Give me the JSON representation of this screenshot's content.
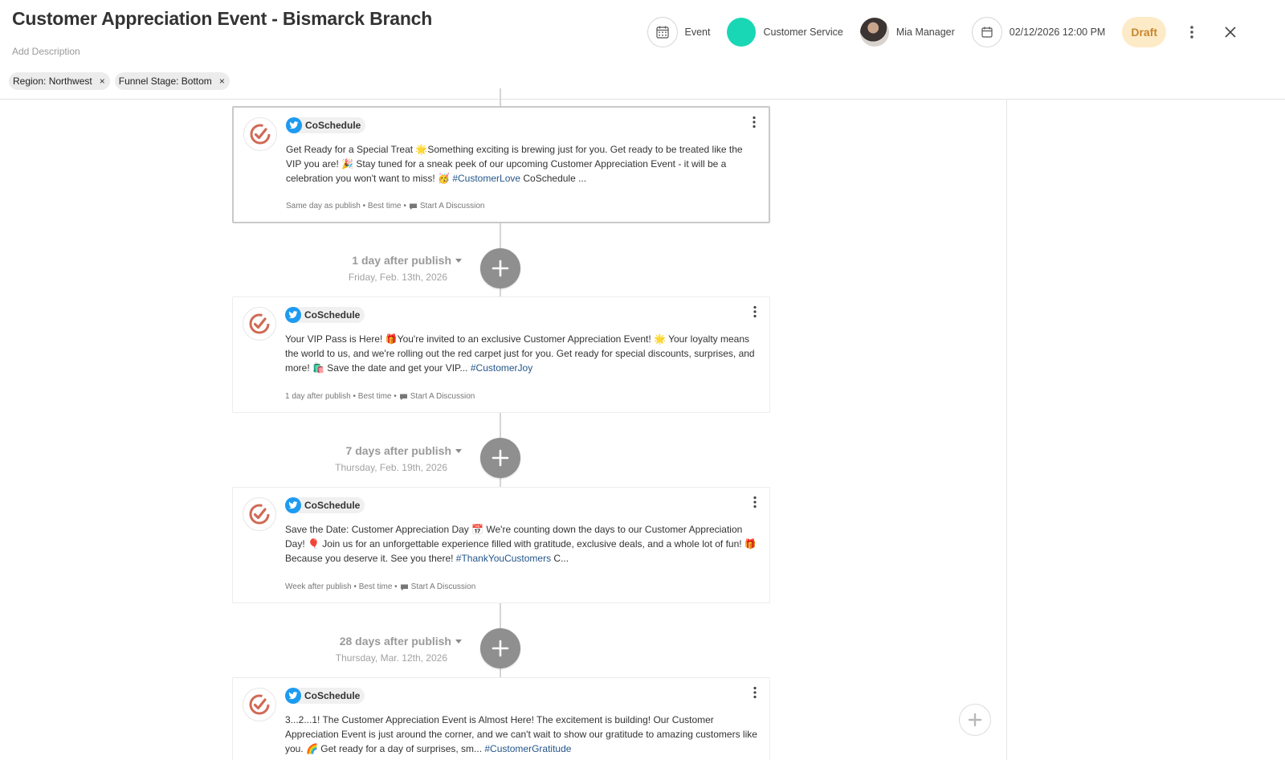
{
  "header": {
    "title": "Customer Appreciation Event - Bismarck Branch",
    "add_description": "Add Description",
    "tags": [
      {
        "label": "Region: Northwest",
        "remove": "×"
      },
      {
        "label": "Funnel Stage: Bottom",
        "remove": "×"
      }
    ],
    "type_label": "Event",
    "team_label": "Customer Service",
    "team_color": "#19d7b4",
    "owner_name": "Mia Manager",
    "datetime": "02/12/2026 12:00 PM",
    "status": "Draft",
    "status_color": "#c8872d"
  },
  "cards": [
    {
      "account": "CoSchedule",
      "text_pre": "Get Ready for a Special Treat 🌟Something exciting is brewing just for you. Get ready to be treated like the VIP you are! 🎉 Stay tuned for a sneak peek of our upcoming Customer Appreciation Event - it will be a celebration you won't want to miss! 🥳 ",
      "hashtag": "#CustomerLove",
      "text_post": " CoSchedule ...",
      "meta_timing": "Same day as publish",
      "meta_best": "Best time",
      "meta_discussion": "Start A Discussion"
    },
    {
      "account": "CoSchedule",
      "text_pre": "Your VIP Pass is Here! 🎁You're invited to an exclusive Customer Appreciation Event! 🌟 Your loyalty means the world to us, and we're rolling out the red carpet just for you. Get ready for special discounts, surprises, and more! 🛍️ Save the date and get your VIP... ",
      "hashtag": "#CustomerJoy",
      "text_post": "",
      "meta_timing": "1 day after publish",
      "meta_best": "Best time",
      "meta_discussion": "Start A Discussion"
    },
    {
      "account": "CoSchedule",
      "text_pre": "Save the Date: Customer Appreciation Day 📅 We're counting down the days to our Customer Appreciation Day! 🎈 Join us for an unforgettable experience filled with gratitude, exclusive deals, and a whole lot of fun! 🎁 Because you deserve it. See you there! ",
      "hashtag": "#ThankYouCustomers",
      "text_post": " C...",
      "meta_timing": "Week after publish",
      "meta_best": "Best time",
      "meta_discussion": "Start A Discussion"
    },
    {
      "account": "CoSchedule",
      "text_pre": "3...2...1! The Customer Appreciation Event is Almost Here! The excitement is building! Our Customer Appreciation Event is just around the corner, and we can't wait to show our gratitude to amazing customers like you. 🌈 Get ready for a day of surprises, sm... ",
      "hashtag": "#CustomerGratitude",
      "text_post": "",
      "meta_timing": "",
      "meta_best": "",
      "meta_discussion": ""
    }
  ],
  "stages": [
    {
      "label": "1 day after publish",
      "date": "Friday, Feb. 13th, 2026"
    },
    {
      "label": "7 days after publish",
      "date": "Thursday, Feb. 19th, 2026"
    },
    {
      "label": "28 days after publish",
      "date": "Thursday, Mar. 12th, 2026"
    }
  ]
}
